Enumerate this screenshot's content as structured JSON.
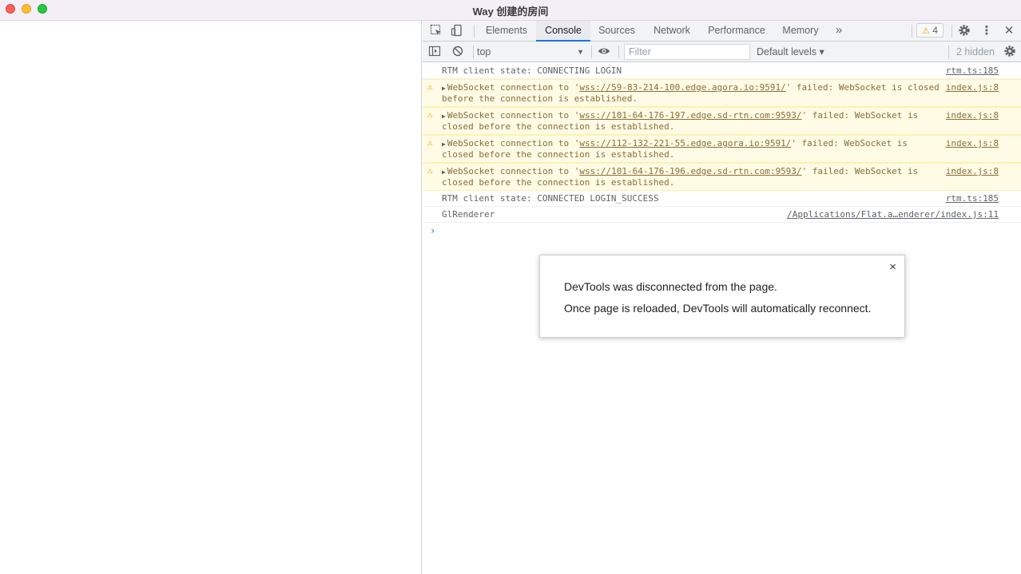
{
  "window": {
    "title": "Way 创建的房间"
  },
  "devtools": {
    "tabs": [
      {
        "label": "Elements"
      },
      {
        "label": "Console"
      },
      {
        "label": "Sources"
      },
      {
        "label": "Network"
      },
      {
        "label": "Performance"
      },
      {
        "label": "Memory"
      }
    ],
    "more_tabs": "»",
    "warning_count": "4",
    "toolbar": {
      "context": "top",
      "filter_placeholder": "Filter",
      "levels": "Default levels ▾",
      "hidden": "2 hidden"
    },
    "messages": [
      {
        "type": "log",
        "text": "RTM client state:  CONNECTING LOGIN",
        "source": "rtm.ts:185"
      },
      {
        "type": "warn",
        "pre": "WebSocket connection to '",
        "url": "wss://59-83-214-100.edge.agora.io:9591/",
        "post": "' failed: WebSocket is closed before the connection is established.",
        "source": "index.js:8"
      },
      {
        "type": "warn",
        "pre": "WebSocket connection to '",
        "url": "wss://101-64-176-197.edge.sd-rtn.com:9593/",
        "post": "' failed: WebSocket is closed before the connection is established.",
        "source": "index.js:8"
      },
      {
        "type": "warn",
        "pre": "WebSocket connection to '",
        "url": "wss://112-132-221-55.edge.agora.io:9591/",
        "post": "' failed: WebSocket is closed before the connection is established.",
        "source": "index.js:8"
      },
      {
        "type": "warn",
        "pre": "WebSocket connection to '",
        "url": "wss://101-64-176-196.edge.sd-rtn.com:9593/",
        "post": "' failed: WebSocket is closed before the connection is established.",
        "source": "index.js:8"
      },
      {
        "type": "log",
        "text": "RTM client state:  CONNECTED LOGIN_SUCCESS",
        "source": "rtm.ts:185"
      },
      {
        "type": "log",
        "text": "GlRenderer",
        "source": "/Applications/Flat.a…enderer/index.js:11"
      }
    ],
    "prompt": "›",
    "dialog": {
      "line1": "DevTools was disconnected from the page.",
      "line2": "Once page is reloaded, DevTools will automatically reconnect.",
      "close": "×"
    }
  },
  "colors": {
    "accent": "#1a73e8",
    "warning": "#f2a600",
    "warning_bg": "#fffbe5"
  }
}
